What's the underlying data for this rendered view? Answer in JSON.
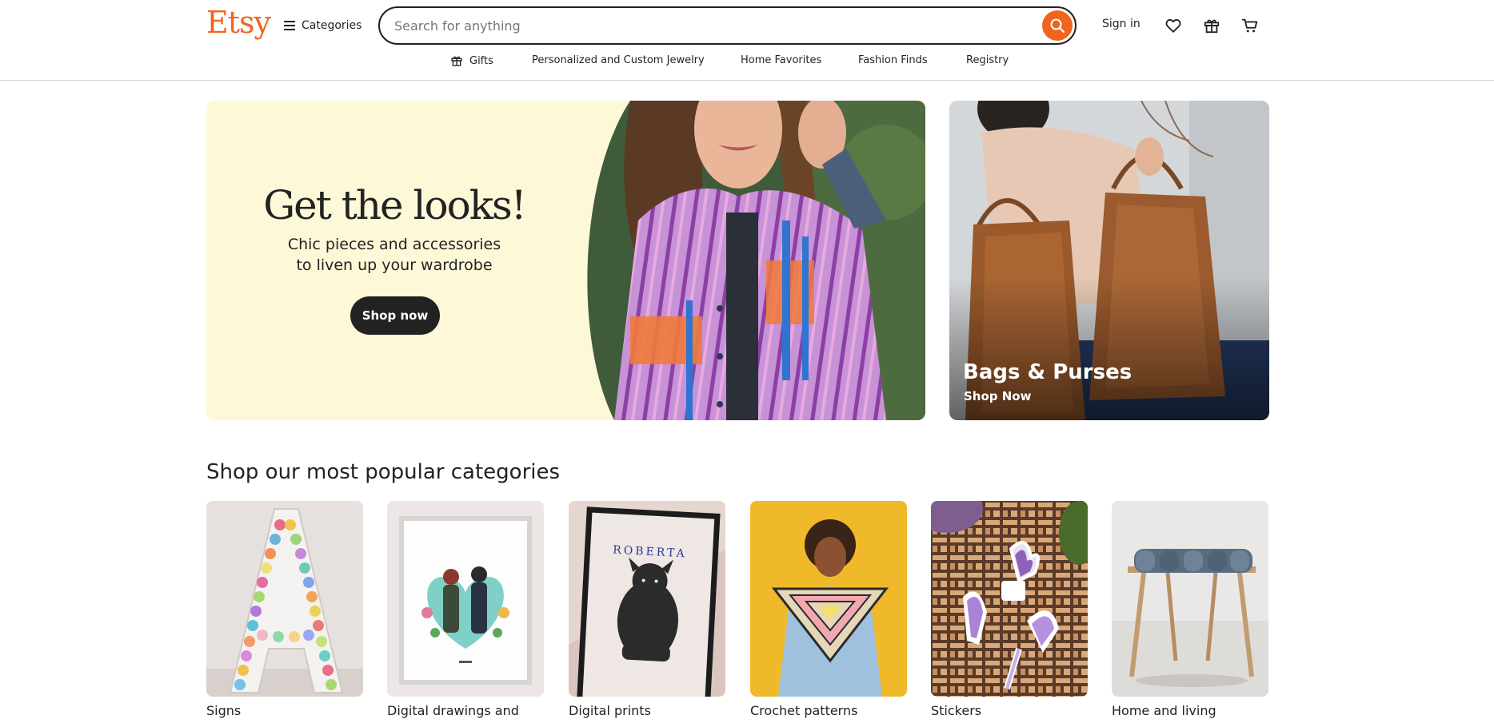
{
  "header": {
    "logo": "Etsy",
    "categories_label": "Categories",
    "search": {
      "placeholder": "Search for anything",
      "value": ""
    },
    "sign_in": "Sign in"
  },
  "subnav": {
    "items": [
      {
        "label": "Gifts",
        "icon": "gift-icon"
      },
      {
        "label": "Personalized and Custom Jewelry"
      },
      {
        "label": "Home Favorites"
      },
      {
        "label": "Fashion Finds"
      },
      {
        "label": "Registry"
      }
    ]
  },
  "hero": {
    "title": "Get the looks!",
    "subtitle_line1": "Chic pieces and accessories",
    "subtitle_line2": "to liven up your wardrobe",
    "button": "Shop now"
  },
  "side_promo": {
    "title": "Bags & Purses",
    "link": "Shop Now"
  },
  "popular": {
    "title": "Shop our most popular categories",
    "categories": [
      {
        "label": "Signs"
      },
      {
        "label": "Digital drawings and illustrations"
      },
      {
        "label": "Digital prints"
      },
      {
        "label": "Crochet patterns"
      },
      {
        "label": "Stickers"
      },
      {
        "label": "Home and living"
      }
    ]
  },
  "colors": {
    "brand": "#f1641e",
    "hero_bg": "#fdf8d8",
    "button_dark": "#222222"
  }
}
